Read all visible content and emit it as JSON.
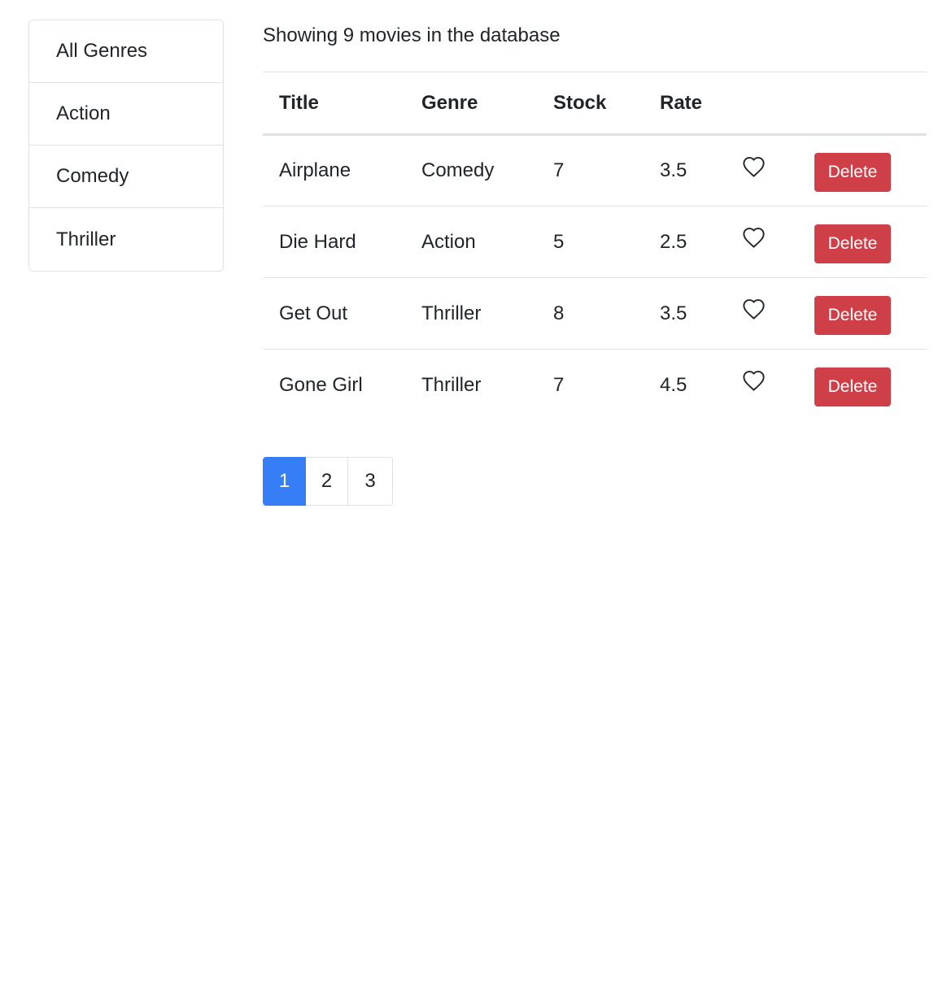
{
  "colors": {
    "primary": "#357ef5",
    "danger": "#cf3f48",
    "border": "#dee2e6",
    "text": "#212529"
  },
  "sidebar": {
    "items": [
      {
        "label": "All Genres",
        "active": false
      },
      {
        "label": "Action",
        "active": false
      },
      {
        "label": "Comedy",
        "active": false
      },
      {
        "label": "Thriller",
        "active": false
      }
    ]
  },
  "main": {
    "summary": "Showing 9 movies in the database"
  },
  "table": {
    "headers": [
      "Title",
      "Genre",
      "Stock",
      "Rate",
      "",
      ""
    ],
    "rows": [
      {
        "title": "Airplane",
        "genre": "Comedy",
        "stock": "7",
        "rate": "3.5",
        "liked": false,
        "action_label": "Delete",
        "like_icon": "heart-outline-icon"
      },
      {
        "title": "Die Hard",
        "genre": "Action",
        "stock": "5",
        "rate": "2.5",
        "liked": false,
        "action_label": "Delete",
        "like_icon": "heart-outline-icon"
      },
      {
        "title": "Get Out",
        "genre": "Thriller",
        "stock": "8",
        "rate": "3.5",
        "liked": false,
        "action_label": "Delete",
        "like_icon": "heart-outline-icon"
      },
      {
        "title": "Gone Girl",
        "genre": "Thriller",
        "stock": "7",
        "rate": "4.5",
        "liked": false,
        "action_label": "Delete",
        "like_icon": "heart-outline-icon"
      }
    ]
  },
  "pagination": {
    "pages": [
      "1",
      "2",
      "3"
    ],
    "current": "1"
  }
}
